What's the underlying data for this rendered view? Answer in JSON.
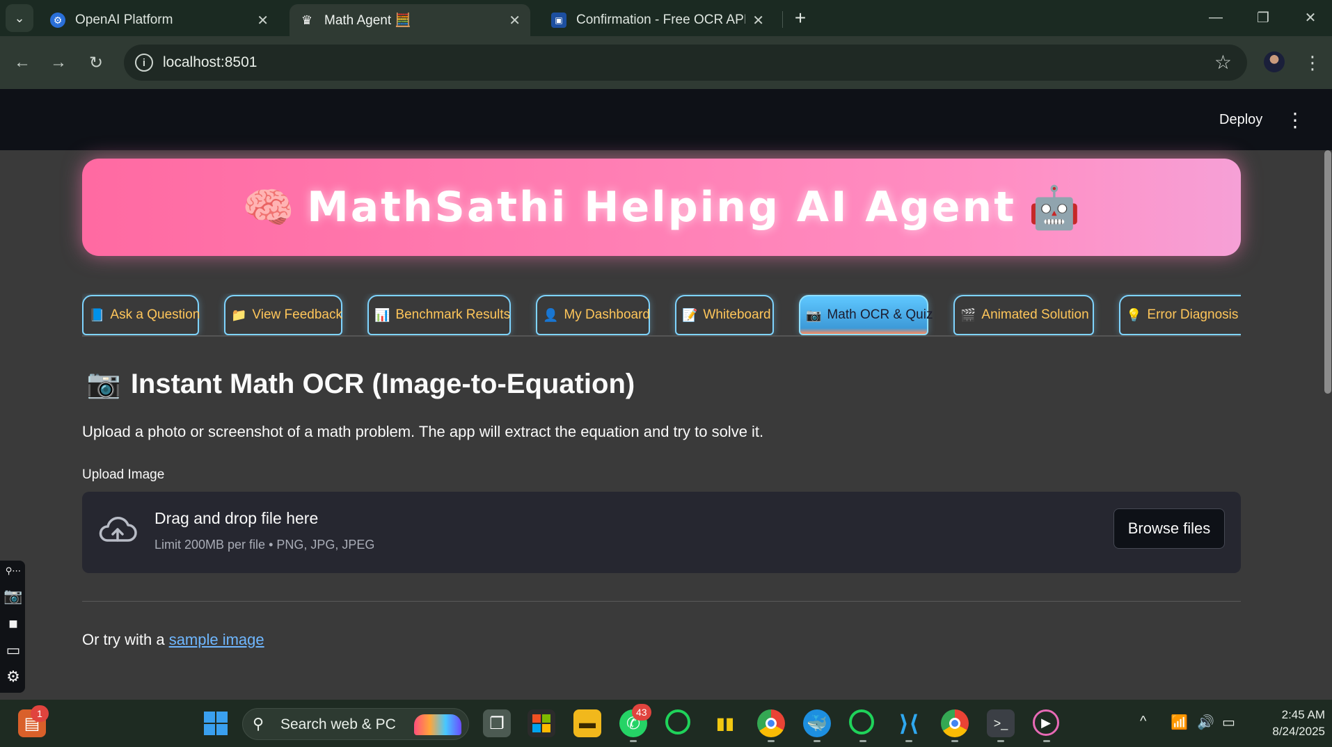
{
  "browser": {
    "tabs": [
      {
        "title": "OpenAI Platform",
        "icon": "openai-icon"
      },
      {
        "title": "Math Agent 🧮",
        "icon": "streamlit-crown-icon",
        "active": true
      },
      {
        "title": "Confirmation - Free OCR API",
        "icon": "ocr-api-icon"
      }
    ],
    "url": "localhost:8501"
  },
  "app": {
    "header": {
      "deploy_label": "Deploy"
    },
    "hero": {
      "left_emoji": "🧠",
      "title": "MathSathi Helping AI Agent",
      "right_emoji": "🤖"
    },
    "tabs": [
      {
        "icon": "📘",
        "label": "Ask a Question"
      },
      {
        "icon": "📁",
        "label": "View Feedback"
      },
      {
        "icon": "📊",
        "label": "Benchmark Results"
      },
      {
        "icon": "👤",
        "label": "My Dashboard"
      },
      {
        "icon": "📝",
        "label": "Whiteboard"
      },
      {
        "icon": "📷",
        "label": "Math OCR & Quiz",
        "active": true
      },
      {
        "icon": "🎬",
        "label": "Animated Solution"
      },
      {
        "icon": "💡",
        "label": "Error Diagnosis"
      }
    ],
    "section": {
      "icon": "📷",
      "title": "Instant Math OCR (Image-to-Equation)",
      "description": "Upload a photo or screenshot of a math problem. The app will extract the equation and try to solve it."
    },
    "uploader": {
      "label": "Upload Image",
      "dropzone_title": "Drag and drop file here",
      "dropzone_limit": "Limit 200MB per file • PNG, JPG, JPEG",
      "browse_label": "Browse files"
    },
    "sample": {
      "prefix": "Or try with a ",
      "link_text": "sample image"
    }
  },
  "taskbar": {
    "search_placeholder": "Search web & PC",
    "badges": {
      "notifications": "1",
      "whatsapp": "43"
    },
    "time": "2:45 AM",
    "date": "8/24/2025"
  },
  "colors": {
    "hero_gradient_start": "#ff6aa2",
    "hero_gradient_end": "#f6a0d6",
    "tab_text": "#ffc65a",
    "tab_border": "#7fd4ff",
    "link": "#6fb7ff"
  }
}
